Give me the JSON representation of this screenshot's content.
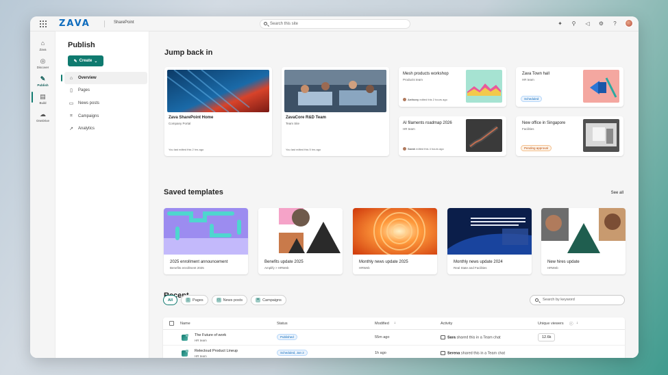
{
  "topbar": {
    "brand": "ZAVA",
    "app_name": "SharePoint",
    "search_placeholder": "Search this site"
  },
  "rail": {
    "items": [
      {
        "label": "Zava",
        "icon": "home-icon"
      },
      {
        "label": "Discover",
        "icon": "compass-icon"
      },
      {
        "label": "Publish",
        "icon": "pen-icon"
      },
      {
        "label": "Build",
        "icon": "layout-icon"
      },
      {
        "label": "OneDrive",
        "icon": "cloud-icon"
      }
    ]
  },
  "sidenav": {
    "title": "Publish",
    "create_label": "Create",
    "items": [
      {
        "label": "Overview",
        "icon": "home-icon"
      },
      {
        "label": "Pages",
        "icon": "page-icon"
      },
      {
        "label": "News posts",
        "icon": "news-icon"
      },
      {
        "label": "Campaigns",
        "icon": "campaign-icon"
      },
      {
        "label": "Analytics",
        "icon": "chart-icon"
      }
    ]
  },
  "jump_back": {
    "heading": "Jump back in",
    "large_cards": [
      {
        "title": "Zava SharePoint Home",
        "subtitle": "Company Portal",
        "meta": "You last edited this 2 hrs ago"
      },
      {
        "title": "ZavaCore R&D Team",
        "subtitle": "Team Site",
        "meta": "You last edited this 5 hrs ago"
      }
    ],
    "small_cards": [
      {
        "title": "Mesh products workshop",
        "subtitle": "Products team",
        "meta_name": "Anthony",
        "meta": "edited this 2 hours ago"
      },
      {
        "title": "Zava Town hall",
        "subtitle": "HR team",
        "badge": "Scheduled"
      },
      {
        "title": "AI filaments roadmap 2026",
        "subtitle": "HR team",
        "meta_name": "Sarah",
        "meta": "edited this 4 hours ago"
      },
      {
        "title": "New office in Singapore",
        "subtitle": "Facilities",
        "badge": "Pending approval"
      }
    ]
  },
  "templates": {
    "heading": "Saved templates",
    "see_all": "See all",
    "items": [
      {
        "title": "2025 enrollment announcement",
        "subtitle": "Benefits enrollment 2025"
      },
      {
        "title": "Benefits update 2025",
        "subtitle": "Amplify > HRWeb"
      },
      {
        "title": "Monthly news update 2025",
        "subtitle": "HRWeb"
      },
      {
        "title": "Monthly news update 2024",
        "subtitle": "Real State and Facilities"
      },
      {
        "title": "New hires update",
        "subtitle": "HRWeb"
      }
    ]
  },
  "recent": {
    "heading": "Recent",
    "filters": [
      "All",
      "Pages",
      "News posts",
      "Campaigns"
    ],
    "search_placeholder": "Search by keyword",
    "columns": {
      "name": "Name",
      "status": "Status",
      "modified": "Modified",
      "activity": "Activity",
      "viewers": "Unique viewers"
    },
    "rows": [
      {
        "name": "The Future of work",
        "team": "HR team",
        "status": "Published",
        "modified": "55m ago",
        "actor": "Sara",
        "activity": "shared this in a Team chat",
        "viewers": "12.6k"
      },
      {
        "name": "Relecloud Product Lineup",
        "team": "HR team",
        "status": "Scheduled, Jan 2",
        "modified": "1h ago",
        "actor": "Serena",
        "activity": "shared this in a Team chat",
        "viewers": ""
      }
    ]
  },
  "colors": {
    "accent": "#0f7a6f",
    "brand": "#0f6cbd"
  }
}
